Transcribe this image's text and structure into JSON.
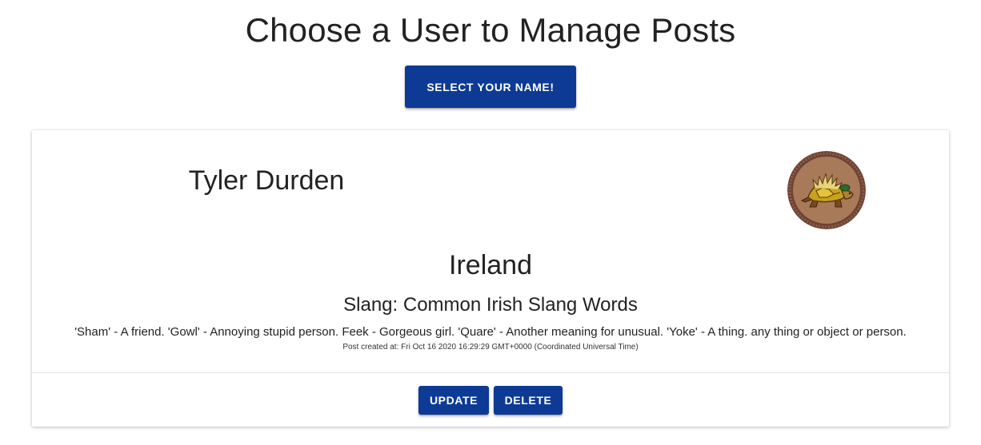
{
  "header": {
    "title": "Choose a User to Manage Posts",
    "select_button_label": "SELECT YOUR NAME!"
  },
  "card": {
    "user_name": "Tyler Durden",
    "avatar_icon": "tortoise-badge-icon",
    "country": "Ireland",
    "post_title": "Slang: Common Irish Slang Words",
    "post_body": "'Sham' - A friend. 'Gowl' - Annoying stupid person. Feek - Gorgeous girl. 'Quare' - Another meaning for unusual. 'Yoke' - A thing. any thing or object or person.",
    "post_date": "Post created at: Fri Oct 16 2020 16:29:29 GMT+0000 (Coordinated Universal Time)",
    "update_label": "UPDATE",
    "delete_label": "DELETE"
  },
  "colors": {
    "primary_button": "#0d3a94",
    "button_text": "#ffffff",
    "text": "#222222"
  }
}
